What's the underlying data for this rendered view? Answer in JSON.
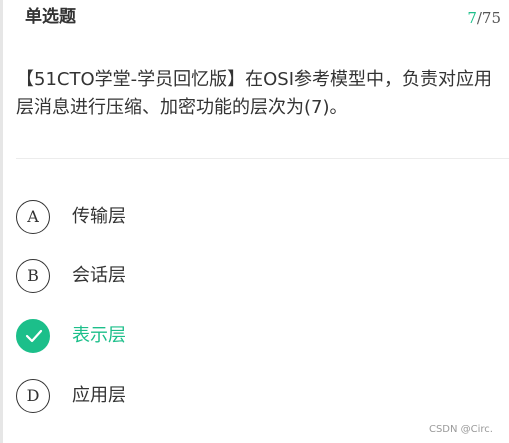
{
  "header": {
    "question_type": "单选题",
    "progress_current": "7",
    "progress_total": "/75"
  },
  "question": {
    "text": "【51CTO学堂-学员回忆版】在OSI参考模型中，负责对应用层消息进行压缩、加密功能的层次为(7)。"
  },
  "options": [
    {
      "key": "A",
      "label": "传输层",
      "selected": false
    },
    {
      "key": "B",
      "label": "会话层",
      "selected": false
    },
    {
      "key": "C",
      "label": "表示层",
      "selected": true
    },
    {
      "key": "D",
      "label": "应用层",
      "selected": false
    }
  ],
  "colors": {
    "accent": "#1cbf8a",
    "text": "#333333"
  },
  "icons": {
    "selected_option": "check-icon"
  },
  "watermark": "CSDN @Circ."
}
